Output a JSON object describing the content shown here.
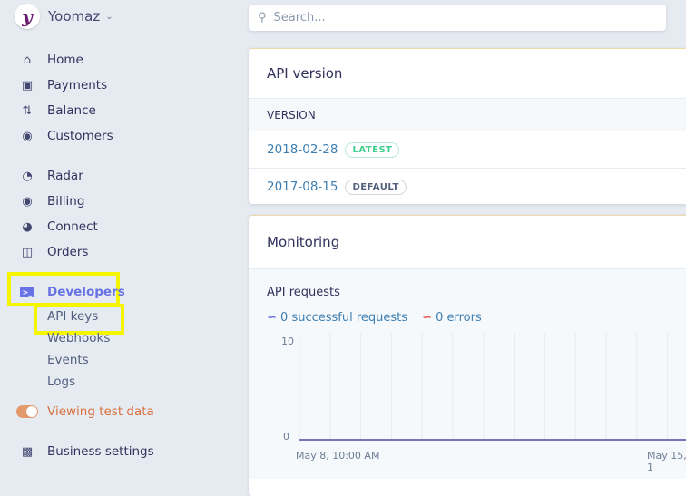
{
  "account": {
    "name": "Yoomaz",
    "logo_letter": "y"
  },
  "search": {
    "placeholder": "Search..."
  },
  "sidebar": {
    "items": [
      {
        "label": "Home",
        "icon": "home-icon"
      },
      {
        "label": "Payments",
        "icon": "payments-icon"
      },
      {
        "label": "Balance",
        "icon": "balance-icon"
      },
      {
        "label": "Customers",
        "icon": "customers-icon"
      },
      {
        "label": "Radar",
        "icon": "radar-icon"
      },
      {
        "label": "Billing",
        "icon": "billing-icon"
      },
      {
        "label": "Connect",
        "icon": "connect-icon"
      },
      {
        "label": "Orders",
        "icon": "orders-icon"
      },
      {
        "label": "Developers",
        "icon": "developers-icon"
      }
    ],
    "developer_sub": [
      "API keys",
      "Webhooks",
      "Events",
      "Logs"
    ],
    "test_data": "Viewing test data",
    "business_settings": "Business settings",
    "accent": "#6772e5",
    "highlight": "#f5f500"
  },
  "api_version": {
    "title": "API version",
    "column": "VERSION",
    "rows": [
      {
        "version": "2018-02-28",
        "badge": "LATEST",
        "badge_color": "#3ecf8e"
      },
      {
        "version": "2017-08-15",
        "badge": "DEFAULT",
        "badge_color": "#525f7f"
      }
    ]
  },
  "monitoring": {
    "title": "Monitoring",
    "chart_title": "API requests",
    "legend": [
      {
        "label": "0 successful requests",
        "color": "#6772e5"
      },
      {
        "label": "0 errors",
        "color": "#e25950"
      }
    ],
    "chart_data": {
      "type": "line",
      "title": "API requests",
      "ylim": [
        0,
        10
      ],
      "yticks": [
        "10",
        "0"
      ],
      "xticks": [
        "May 8, 10:00 AM",
        "May 15, 1"
      ],
      "series": [
        {
          "name": "successful requests",
          "values": [
            0,
            0,
            0,
            0,
            0,
            0,
            0,
            0,
            0,
            0,
            0,
            0,
            0,
            0
          ]
        },
        {
          "name": "errors",
          "values": [
            0,
            0,
            0,
            0,
            0,
            0,
            0,
            0,
            0,
            0,
            0,
            0,
            0,
            0
          ]
        }
      ],
      "grid": true
    }
  }
}
